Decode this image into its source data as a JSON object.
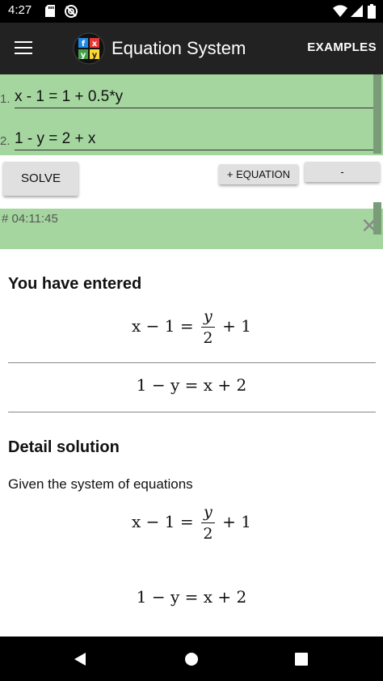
{
  "status_bar": {
    "time": "4:27",
    "icons": [
      "sd-card-icon",
      "no-sync-icon",
      "wifi-icon",
      "signal-icon",
      "battery-icon"
    ]
  },
  "app_bar": {
    "title": "Equation System",
    "examples_label": "EXAMPLES",
    "logo_letters": [
      "f",
      "x",
      "y",
      "y"
    ]
  },
  "equations": [
    {
      "number": "1.",
      "value": "x - 1 = 1 + 0.5*y"
    },
    {
      "number": "2.",
      "value": "1 - y = 2 + x"
    }
  ],
  "buttons": {
    "solve": "SOLVE",
    "add_equation": "+ EQUATION",
    "remove": "-"
  },
  "history": {
    "stamp": "# 04:11:45",
    "close": "✕"
  },
  "entered": {
    "heading": "You have entered",
    "eq1": {
      "lhs": "x − 1 =",
      "frac_num": "y",
      "frac_den": "2",
      "rhs": "+ 1"
    },
    "eq2": "1 − y = x + 2"
  },
  "detail": {
    "heading": "Detail solution",
    "intro": "Given the system of equations",
    "eq1": {
      "lhs": "x − 1 =",
      "frac_num": "y",
      "frac_den": "2",
      "rhs": "+ 1"
    },
    "eq2": "1 − y = x + 2"
  },
  "colors": {
    "accent_green": "#a5d6a0",
    "app_bar": "#222222",
    "button": "#e0e0e0"
  }
}
